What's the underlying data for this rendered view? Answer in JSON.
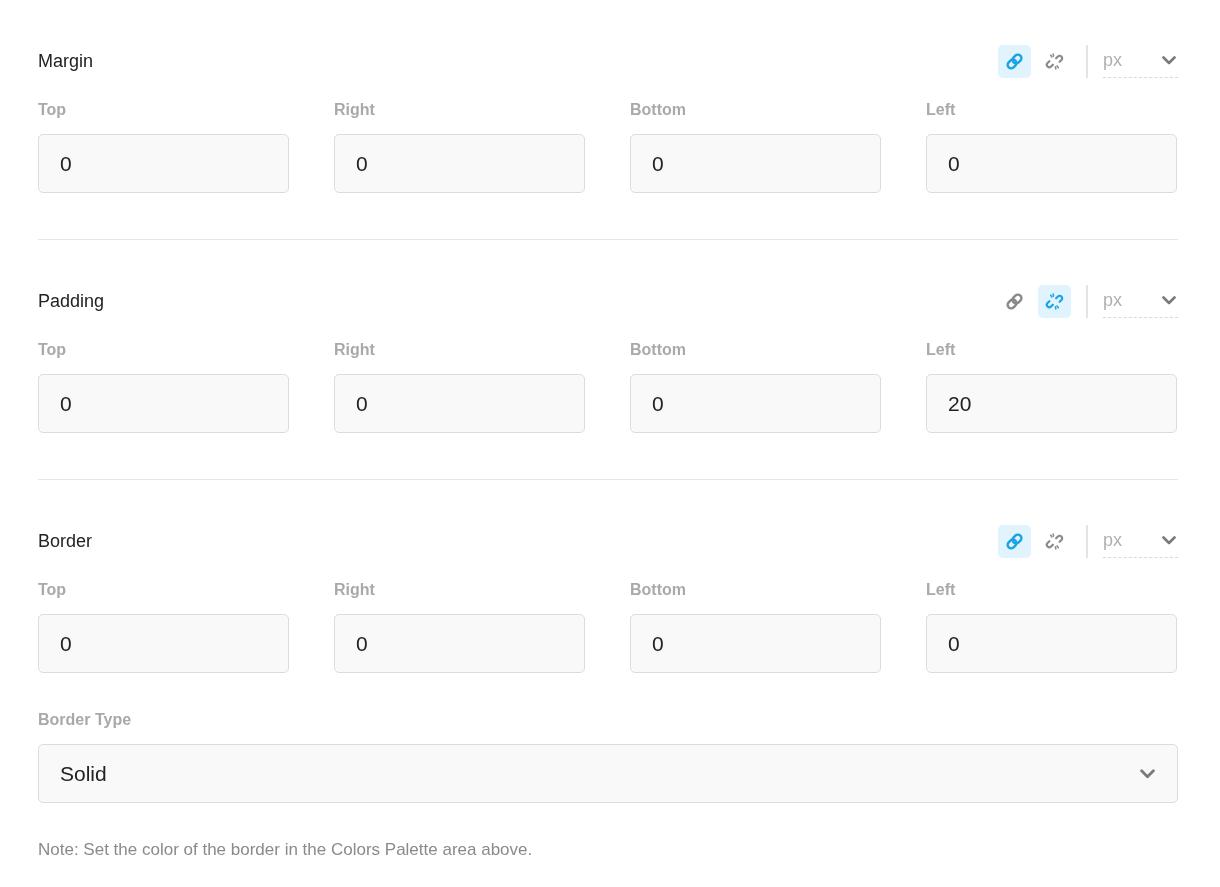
{
  "sections": [
    {
      "title": "Margin",
      "link_buttons": [
        {
          "kind": "link",
          "selected": true
        },
        {
          "kind": "unlink",
          "selected": false
        }
      ],
      "unit": "px",
      "fields": [
        {
          "label": "Top",
          "value": "0"
        },
        {
          "label": "Right",
          "value": "0"
        },
        {
          "label": "Bottom",
          "value": "0"
        },
        {
          "label": "Left",
          "value": "0"
        }
      ]
    },
    {
      "title": "Padding",
      "link_buttons": [
        {
          "kind": "link",
          "selected": false
        },
        {
          "kind": "unlink",
          "selected": true
        }
      ],
      "unit": "px",
      "fields": [
        {
          "label": "Top",
          "value": "0"
        },
        {
          "label": "Right",
          "value": "0"
        },
        {
          "label": "Bottom",
          "value": "0"
        },
        {
          "label": "Left",
          "value": "20"
        }
      ]
    },
    {
      "title": "Border",
      "link_buttons": [
        {
          "kind": "link",
          "selected": true
        },
        {
          "kind": "unlink",
          "selected": false
        }
      ],
      "unit": "px",
      "fields": [
        {
          "label": "Top",
          "value": "0"
        },
        {
          "label": "Right",
          "value": "0"
        },
        {
          "label": "Bottom",
          "value": "0"
        },
        {
          "label": "Left",
          "value": "0"
        }
      ]
    }
  ],
  "border_type": {
    "label": "Border Type",
    "value": "Solid"
  },
  "note": "Note: Set the color of the border in the Colors Palette area above."
}
